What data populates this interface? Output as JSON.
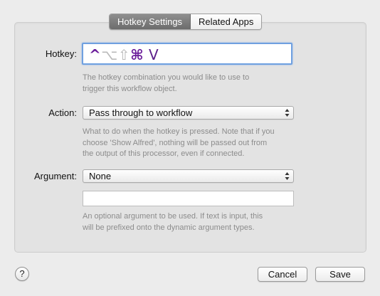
{
  "tabs": [
    {
      "label": "Hotkey Settings",
      "active": true
    },
    {
      "label": "Related Apps",
      "active": false
    }
  ],
  "hotkey": {
    "label": "Hotkey:",
    "modifiers": {
      "control": "^",
      "option": "⌥",
      "shift": "⇧",
      "command": "⌘"
    },
    "key": "V",
    "help": [
      "The hotkey combination you would like to use to",
      "trigger this workflow object."
    ]
  },
  "action": {
    "label": "Action:",
    "value": "Pass through to workflow",
    "help": [
      "What to do when the hotkey is pressed. Note that if you",
      "choose 'Show Alfred', nothing will be passed out from",
      "the output of this processor, even if connected."
    ]
  },
  "argument": {
    "label": "Argument:",
    "value": "None",
    "text_value": "",
    "help": [
      "An optional argument to be used. If text is input, this",
      "will be prefixed onto the dynamic argument types."
    ]
  },
  "footer": {
    "help_label": "?",
    "cancel_label": "Cancel",
    "save_label": "Save"
  },
  "colors": {
    "hotkey_symbol": "#6a1b9a",
    "focus_ring": "#6fa0e0",
    "help_text": "#8c8c8c"
  }
}
